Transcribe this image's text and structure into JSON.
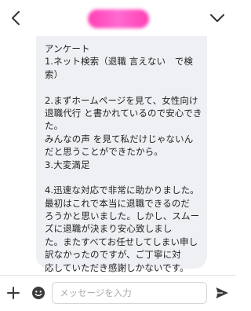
{
  "header": {
    "contact_name": "　"
  },
  "message": {
    "lines": [
      "アンケート",
      "1.ネット検索（退職 言えない　で検",
      "索）",
      "",
      "2.まずホームページを見て、女性向け",
      "退職代行 と書かれているので安心でき",
      "た。",
      "みんなの声 を見て私だけじゃないん",
      "だと思うことができたから。",
      "3.大変満足",
      "",
      "4.迅速な対応で非常に助かりました。",
      "最初はこれで本当に退職できるのだ",
      "ろうかと思いました。しかし、スムー",
      "ズに退職が決まり安心致しまし",
      "た。またすべてお任せしてしまい申し",
      "訳なかったのですが、ご丁寧に対",
      "応していただき感謝しかないです。"
    ]
  },
  "input": {
    "placeholder": "メッセージを入力",
    "value": ""
  },
  "icons": {
    "back": "chevron-left-icon",
    "menu": "chevron-down-icon",
    "add": "plus-icon",
    "emoji": "emoji-icon",
    "send": "send-icon"
  },
  "colors": {
    "bubble": "#eef0f4",
    "accent_name": "#ff4fc0",
    "icon": "#3b3b3b"
  }
}
